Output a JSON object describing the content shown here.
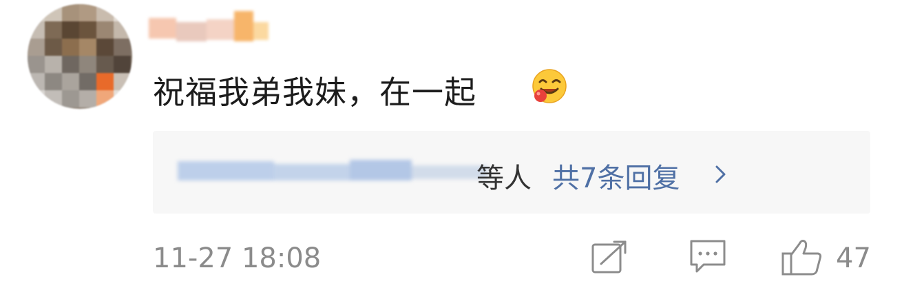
{
  "comment": {
    "author_avatar": "blurred-avatar",
    "author_name": "",
    "text": "祝福我弟我妹，在一起",
    "emoji": "drooling-face-emoji",
    "replies": {
      "names_blurred": true,
      "suffix": "等人",
      "count_label": "共7条回复",
      "chevron": "chevron-right-icon"
    },
    "timestamp": "11-27 18:08",
    "actions": {
      "share_icon": "share-icon",
      "comment_icon": "comment-icon",
      "like_icon": "thumbs-up-icon",
      "like_count": "47"
    }
  },
  "colors": {
    "text_primary": "#1c1c1c",
    "text_secondary": "#8b8b8b",
    "link_blue": "#4f70a5",
    "reply_bg": "#f7f7f7",
    "icon_gray": "#8c8c8c"
  }
}
